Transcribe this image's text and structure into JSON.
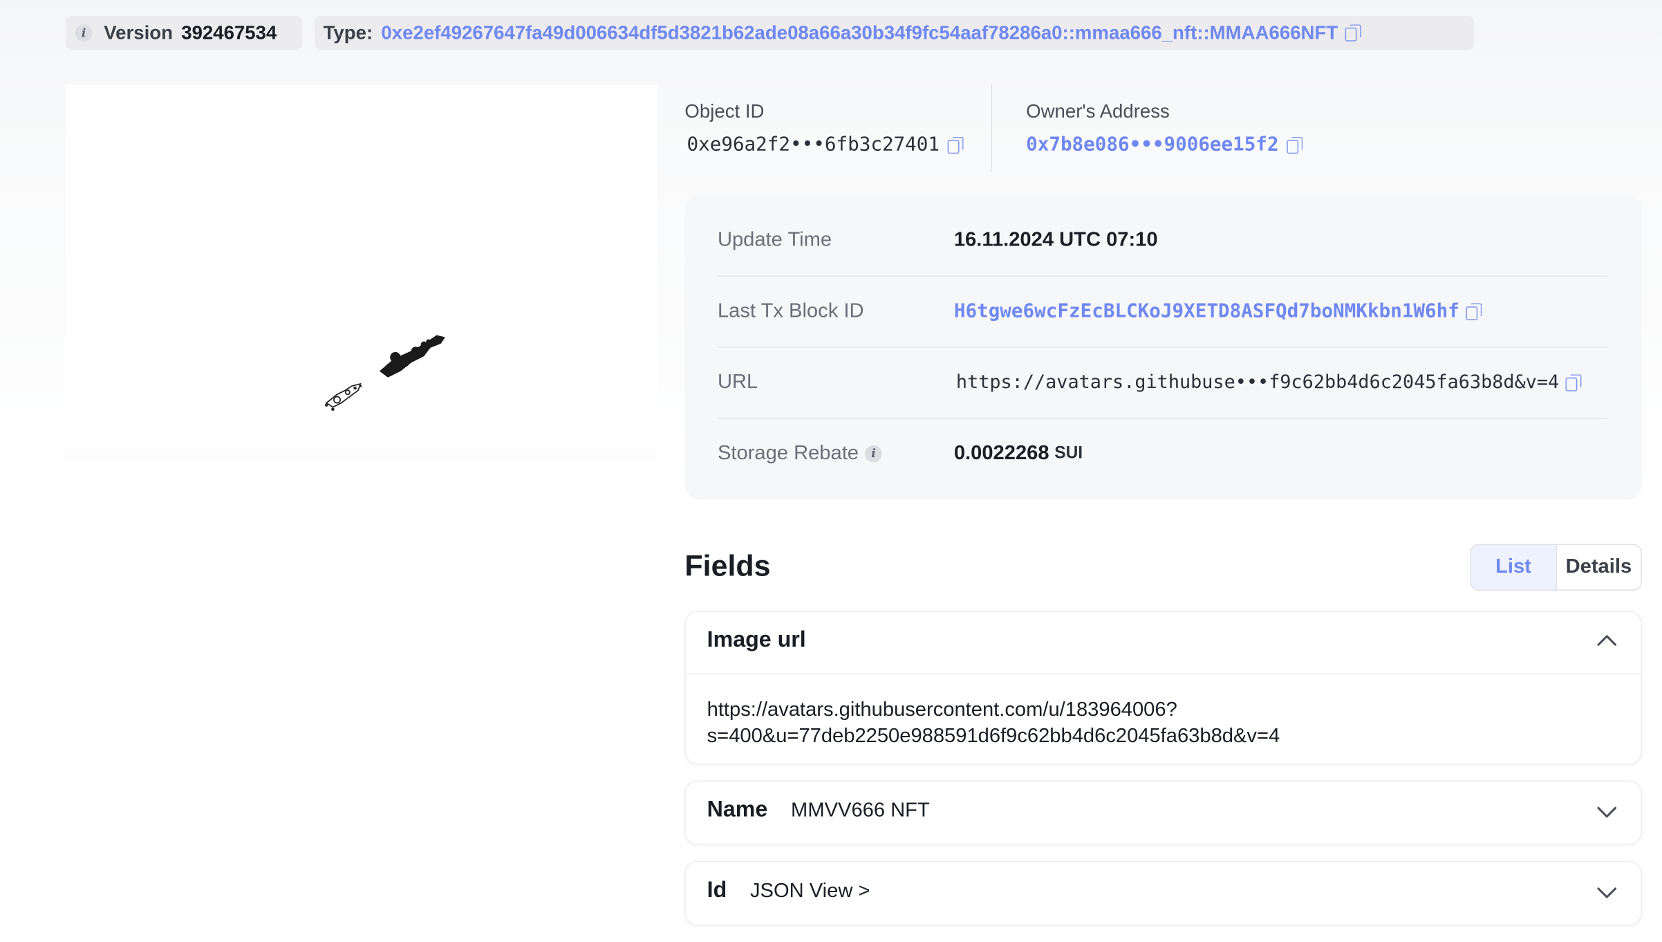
{
  "header": {
    "version_label": "Version",
    "version_value": "392467534",
    "type_label": "Type:",
    "type_value": "0xe2ef49267647fa49d006634df5d3821b62ade08a66a30b34f9fc54aaf78286a0::mmaa666_nft::MMAA666NFT"
  },
  "object": {
    "id_label": "Object ID",
    "id_value": "0xe96a2f2•••6fb3c27401",
    "owner_label": "Owner's Address",
    "owner_value": "0x7b8e086•••9006ee15f2"
  },
  "details": {
    "rows": [
      {
        "label": "Update Time",
        "value": "16.11.2024 UTC 07:10"
      },
      {
        "label": "Last Tx Block ID",
        "value": "H6tgwe6wcFzEcBLCKoJ9XETD8ASFQd7boNMKkbn1W6hf"
      },
      {
        "label": "URL",
        "value": "https://avatars.githubuse•••f9c62bb4d6c2045fa63b8d&v=4"
      },
      {
        "label": "Storage Rebate",
        "value": "0.0022268",
        "unit": "SUI"
      }
    ]
  },
  "fields": {
    "title": "Fields",
    "toggle": {
      "list": "List",
      "details": "Details",
      "active": "List"
    },
    "items": [
      {
        "name": "Image url",
        "expanded": true,
        "line1": "https://avatars.githubusercontent.com/u/183964006?",
        "line2": "s=400&u=77deb2250e988591d6f9c62bb4d6c2045fa63b8d&v=4"
      },
      {
        "name": "Name",
        "value": "MMVV666 NFT",
        "expanded": false
      },
      {
        "name": "Id",
        "value": "JSON View >",
        "expanded": false
      }
    ]
  },
  "colors": {
    "accent": "#6f87f0",
    "card_bg": "#f6f7f9"
  }
}
